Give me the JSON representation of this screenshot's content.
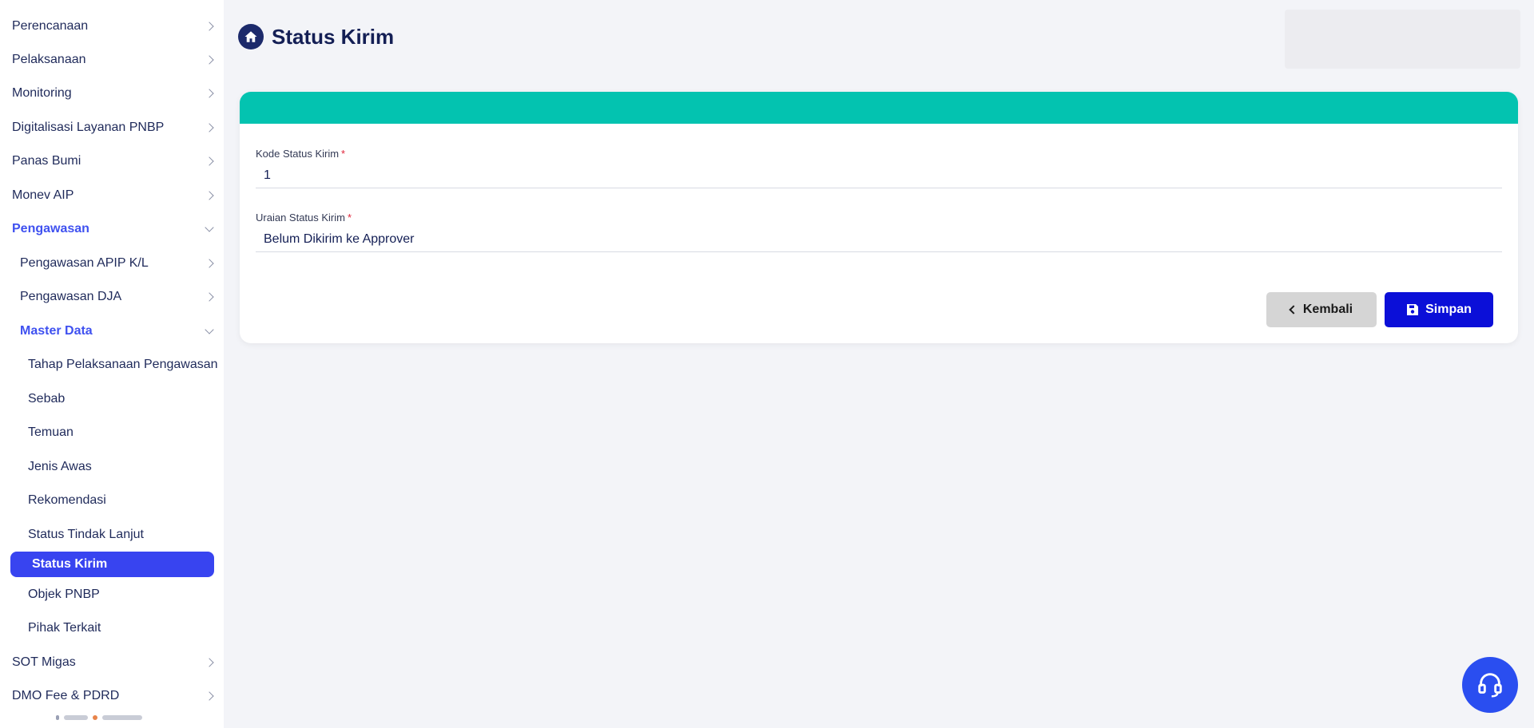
{
  "sidebar": {
    "items": [
      {
        "label": "Perencanaan"
      },
      {
        "label": "Pelaksanaan"
      },
      {
        "label": "Monitoring"
      },
      {
        "label": "Digitalisasi Layanan PNBP"
      },
      {
        "label": "Panas Bumi"
      },
      {
        "label": "Monev AIP"
      },
      {
        "label": "Pengawasan"
      },
      {
        "label": "Pengawasan APIP K/L"
      },
      {
        "label": "Pengawasan DJA"
      },
      {
        "label": "Master Data"
      },
      {
        "label": "Tahap Pelaksanaan Pengawasan"
      },
      {
        "label": "Sebab"
      },
      {
        "label": "Temuan"
      },
      {
        "label": "Jenis Awas"
      },
      {
        "label": "Rekomendasi"
      },
      {
        "label": "Status Tindak Lanjut"
      },
      {
        "label": "Status Kirim"
      },
      {
        "label": "Objek PNBP"
      },
      {
        "label": "Pihak Terkait"
      },
      {
        "label": "SOT Migas"
      },
      {
        "label": "DMO Fee & PDRD"
      }
    ]
  },
  "header": {
    "title": "Status Kirim",
    "icon": "home-icon"
  },
  "form": {
    "kode": {
      "label": "Kode Status Kirim",
      "required_mark": "*",
      "value": "1"
    },
    "uraian": {
      "label": "Uraian Status Kirim",
      "required_mark": "*",
      "value": "Belum Dikirim ke Approver"
    },
    "back_label": "Kembali",
    "save_label": "Simpan"
  },
  "colors": {
    "accent": "#3844f0",
    "card_header": "#03c3b0",
    "save_button": "#0b0fd8",
    "help_button": "#2a4ef0"
  }
}
